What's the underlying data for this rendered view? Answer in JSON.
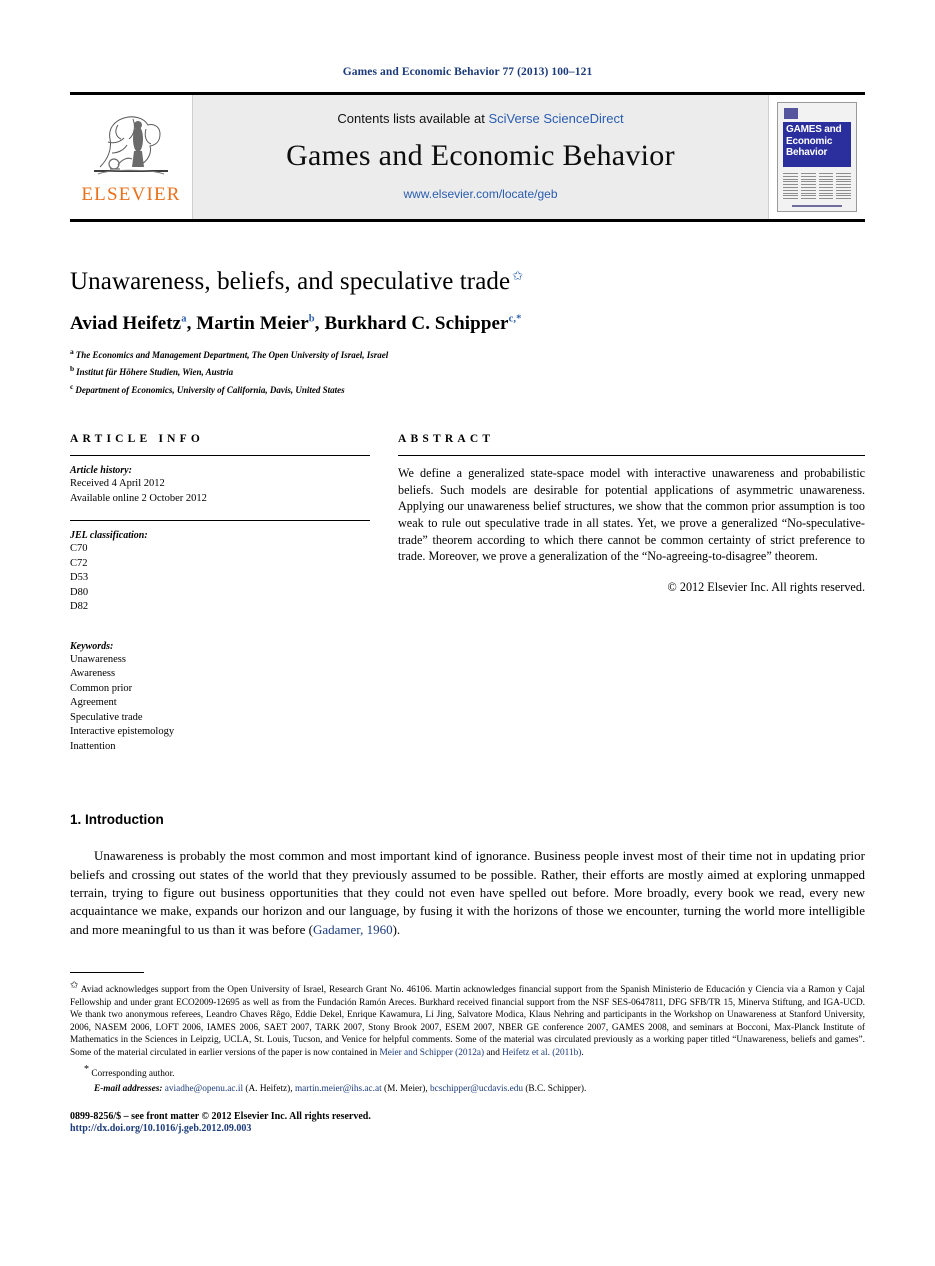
{
  "running_head": "Games and Economic Behavior 77 (2013) 100–121",
  "masthead": {
    "publisher_name": "ELSEVIER",
    "contents_prefix": "Contents lists available at ",
    "contents_link": "SciVerse ScienceDirect",
    "journal_name": "Games and Economic Behavior",
    "journal_url": "www.elsevier.com/locate/geb",
    "cover_title": "GAMES and Economic Behavior"
  },
  "article": {
    "title": "Unawareness, beliefs, and speculative trade",
    "title_mark": "✩",
    "authors_plain": "Aviad Heifetz a, Martin Meier b, Burkhard C. Schipper c,*",
    "authors": [
      {
        "name": "Aviad Heifetz",
        "mark": "a"
      },
      {
        "name": "Martin Meier",
        "mark": "b"
      },
      {
        "name": "Burkhard C. Schipper",
        "mark": "c,*"
      }
    ],
    "affiliations": [
      {
        "label": "a",
        "text": "The Economics and Management Department, The Open University of Israel, Israel"
      },
      {
        "label": "b",
        "text": "Institut für Höhere Studien, Wien, Austria"
      },
      {
        "label": "c",
        "text": "Department of Economics, University of California, Davis, United States"
      }
    ]
  },
  "info": {
    "heading": "ARTICLE INFO",
    "history_label": "Article history:",
    "history": [
      "Received 4 April 2012",
      "Available online 2 October 2012"
    ],
    "jel_label": "JEL classification:",
    "jel_codes": [
      "C70",
      "C72",
      "D53",
      "D80",
      "D82"
    ],
    "keywords_label": "Keywords:",
    "keywords": [
      "Unawareness",
      "Awareness",
      "Common prior",
      "Agreement",
      "Speculative trade",
      "Interactive epistemology",
      "Inattention"
    ]
  },
  "abstract": {
    "heading": "ABSTRACT",
    "text": "We define a generalized state-space model with interactive unawareness and probabilistic beliefs. Such models are desirable for potential applications of asymmetric unawareness. Applying our unawareness belief structures, we show that the common prior assumption is too weak to rule out speculative trade in all states. Yet, we prove a generalized “No-speculative-trade” theorem according to which there cannot be common certainty of strict preference to trade. Moreover, we prove a generalization of the “No-agreeing-to-disagree” theorem.",
    "copyright": "© 2012 Elsevier Inc. All rights reserved."
  },
  "body": {
    "section_number_title": "1. Introduction",
    "paragraph_1_before_ref": "Unawareness is probably the most common and most important kind of ignorance. Business people invest most of their time not in updating prior beliefs and crossing out states of the world that they previously assumed to be possible. Rather, their efforts are mostly aimed at exploring unmapped terrain, trying to figure out business opportunities that they could not even have spelled out before. More broadly, every book we read, every new acquaintance we make, expands our horizon and our language, by fusing it with the horizons of those we encounter, turning the world more intelligible and more meaningful to us than it was before (",
    "paragraph_1_ref": "Gadamer, 1960",
    "paragraph_1_after_ref": ")."
  },
  "footnotes": {
    "star_symbol": "✩",
    "acknowledgement_part1": "Aviad acknowledges support from the Open University of Israel, Research Grant No. 46106. Martin acknowledges financial support from the Spanish Ministerio de Educación y Ciencia via a Ramon y Cajal Fellowship and under grant ECO2009-12695 as well as from the Fundación Ramón Areces. Burkhard received financial support from the NSF SES-0647811, DFG SFB/TR 15, Minerva Stiftung, and IGA-UCD. We thank two anonymous referees, Leandro Chaves Rêgo, Eddie Dekel, Enrique Kawamura, Li Jing, Salvatore Modica, Klaus Nehring and participants in the Workshop on Unawareness at Stanford University, 2006, NASEM 2006, LOFT 2006, IAMES 2006, SAET 2007, TARK 2007, Stony Brook 2007, ESEM 2007, NBER GE conference 2007, GAMES 2008, and seminars at Bocconi, Max-Planck Institute of Mathematics in the Sciences in Leipzig, UCLA, St. Louis, Tucson, and Venice for helpful comments. Some of the material was circulated previously as a working paper titled “Unawareness, beliefs and games”. Some of the material circulated in earlier versions of the paper is now contained in ",
    "ref_meier_schipper": "Meier and Schipper (2012a)",
    "acknowledgement_joiner": " and ",
    "ref_heifetz": "Heifetz et al. (2011b)",
    "acknowledgement_end": ".",
    "corresponding_mark": "*",
    "corresponding_text": "Corresponding author.",
    "email_label": "E-mail addresses:",
    "emails": [
      {
        "address": "aviadhe@openu.ac.il",
        "owner": "(A. Heifetz)"
      },
      {
        "address": "martin.meier@ihs.ac.at",
        "owner": "(M. Meier)"
      },
      {
        "address": "bcschipper@ucdavis.edu",
        "owner": "(B.C. Schipper)"
      }
    ]
  },
  "footer": {
    "issn_line": "0899-8256/$ – see front matter © 2012 Elsevier Inc. All rights reserved.",
    "doi": "http://dx.doi.org/10.1016/j.geb.2012.09.003"
  },
  "colors": {
    "link_blue": "#2a5db0",
    "ref_blue": "#1a3a7a",
    "elsevier_orange": "#E9711C",
    "masthead_gray": "#ececec",
    "cover_blue": "#2b2f9e"
  }
}
